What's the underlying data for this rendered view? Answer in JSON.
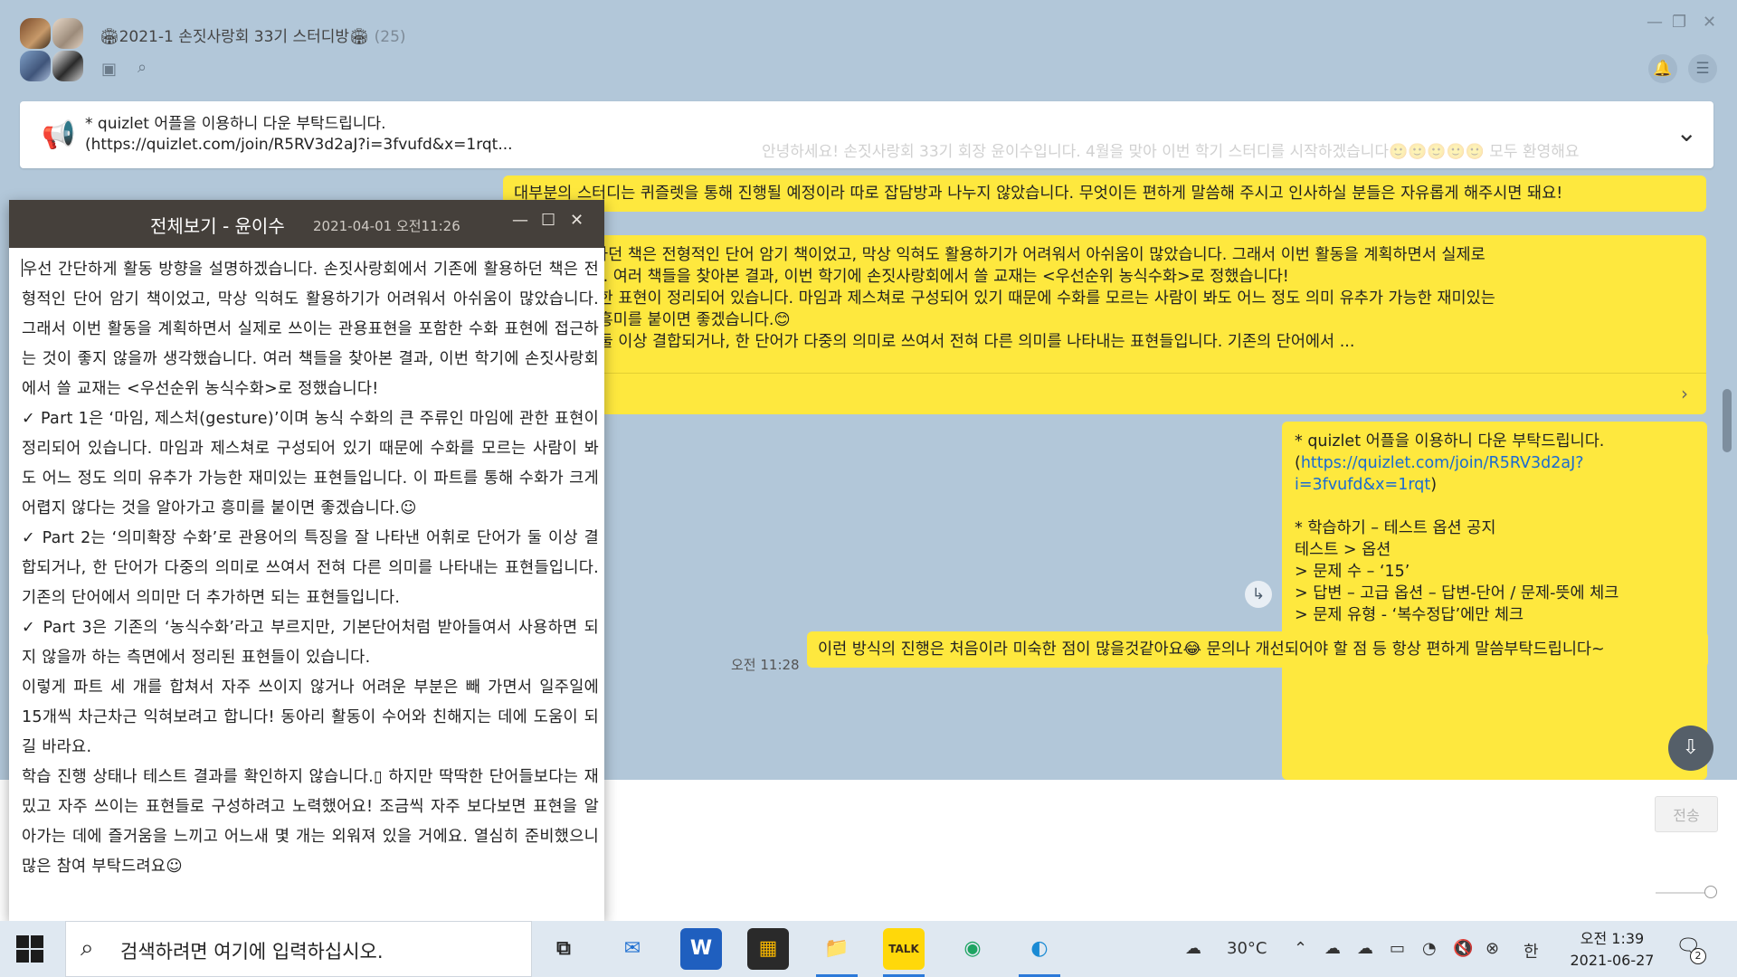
{
  "chat_window": {
    "title": "🏟2021-1 손짓사랑회 33기 스터디방🏟",
    "member_count": "(25)",
    "icons": [
      "drawer-icon",
      "search-icon",
      "minimize-icon",
      "restore-icon",
      "close-icon",
      "bell-icon",
      "menu-icon"
    ]
  },
  "notice": {
    "line1": "* quizlet 어플을 이용하니 다운 부탁드립니다.",
    "line2": "(https://quizlet.com/join/R5RV3d2aJ?i=3fvufd&x=1rqt..."
  },
  "faded_text": "안녕하세요! 손짓사랑회 33기 회장 윤이수입니다. 4월을 맞아 이번 학기 스터디를 시작하겠습니다🙂🙂🙂🙂🙂 모두 환영해요",
  "messages": {
    "m1": "대부분의 스터디는 퀴즐렛을 통해 진행될 예정이라 따로 잡담방과 나누지 않았습니다. 무엇이든 편하게 말씀해 주시고 인사하실 분들은 자유롭게 해주시면 돼요!",
    "m2_lines": [
      "기존에 활용하던 책은 전형적인 단어 암기 책이었고, 막상 익혀도 활용하기가 어려워서 아쉬움이 많았습니다. 그래서 이번 활동을 계획하면서 실제로",
      "생각했습니다. 여러 책들을 찾아본 결과, 이번 학기에 손짓사랑회에서 쓸 교재는 <우선순위 농식수화>로 정했습니다!",
      "인 마임에 관한 표현이 정리되어 있습니다. 마임과 제스쳐로 구성되어 있기 때문에 수화를 모르는 사람이 봐도 어느 정도 의미 유추가 가능한 재미있는",
      "을 알아가고 흥미를 붙이면 좋겠습니다.😊",
      "휘로 단어가 둘 이상 결합되거나, 한 단어가 다중의 의미로 쓰여서 전혀 다른 의미를 나타내는 표현들입니다. 기존의 단어에서 ..."
    ],
    "m3": {
      "line1": "* quizlet 어플을 이용하니 다운 부탁드립니다.",
      "link_open": "(",
      "link": "https://quizlet.com/join/R5RV3d2aJ?i=3fvufd&x=1rqt",
      "link_close": ")",
      "line3": "* 학습하기 – 테스트 옵션 공지",
      "line4": "테스트 >  옵션",
      "line5": "> 문제 수 – ‘15’",
      "line6": "> 답변 – 고급 옵션 – 답변-단어 / 문제-뜻에 체크",
      "line7": "> 문제 유형 - ‘복수정답’에만 체크"
    },
    "m4": "이런 방식의 진행은 처음이라 미숙한 점이 많을것같아요😂 문의나 개선되어야 할 점 등 항상 편하게 말씀부탁드립니다~",
    "time": "오전 11:28"
  },
  "input": {
    "send_label": "전송"
  },
  "popup": {
    "title": "전체보기 - 윤이수",
    "date": "2021-04-01 오전11:26",
    "paragraphs": [
      "우선 간단하게 활동 방향을 설명하겠습니다. 손짓사랑회에서 기존에 활용하던 책은 전형적인 단어 암기 책이었고, 막상 익혀도 활용하기가 어려워서 아쉬움이 많았습니다. 그래서 이번 활동을 계획하면서 실제로 쓰이는 관용표현을 포함한 수화 표현에 접근하는 것이 좋지 않을까 생각했습니다. 여러 책들을 찾아본 결과, 이번 학기에 손짓사랑회에서 쓸 교재는 <우선순위 농식수화>로 정했습니다!",
      "✓ Part 1은 ‘마임, 제스처(gesture)’이며 농식 수화의 큰 주류인 마임에 관한 표현이 정리되어 있습니다. 마임과 제스쳐로 구성되어 있기 때문에 수화를 모르는 사람이 봐도 어느 정도 의미 유추가 가능한 재미있는 표현들입니다. 이 파트를 통해 수화가 크게 어렵지 않다는 것을 알아가고 흥미를 붙이면 좋겠습니다.☺",
      "✓ Part 2는 ‘의미확장 수화’로 관용어의 특징을 잘 나타낸 어휘로 단어가 둘 이상 결합되거나, 한 단어가 다중의 의미로 쓰여서 전혀 다른 의미를 나타내는 표현들입니다. 기존의 단어에서 의미만 더 추가하면 되는 표현들입니다.",
      "✓ Part 3은 기존의 ‘농식수화’라고 부르지만, 기본단어처럼 받아들여서 사용하면 되지 않을까 하는 측면에서 정리된 표현들이 있습니다.",
      "이렇게 파트 세 개를 합쳐서 자주 쓰이지 않거나 어려운 부분은 빼 가면서 일주일에 15개씩 차근차근 익혀보려고 합니다! 동아리 활동이 수어와 친해지는 데에 도움이 되길 바라요.",
      "학습 진행 상태나 테스트 결과를 확인하지 않습니다.▯ 하지만 딱딱한 단어들보다는 재밌고 자주 쓰이는 표현들로 구성하려고 노력했어요! 조금씩 자주 보다보면 표현을 알아가는 데에 즐거움을 느끼고 어느새 몇 개는 외워져 있을 거에요. 열심히 준비했으니 많은 참여 부탁드려요☺"
    ]
  },
  "taskbar": {
    "search_placeholder": "검색하려면 여기에 입력하십시오.",
    "weather": "30°C",
    "ime": "한",
    "clock_time": "오전 1:39",
    "clock_date": "2021-06-27",
    "notification_count": "2",
    "kakao_label": "TALK"
  }
}
